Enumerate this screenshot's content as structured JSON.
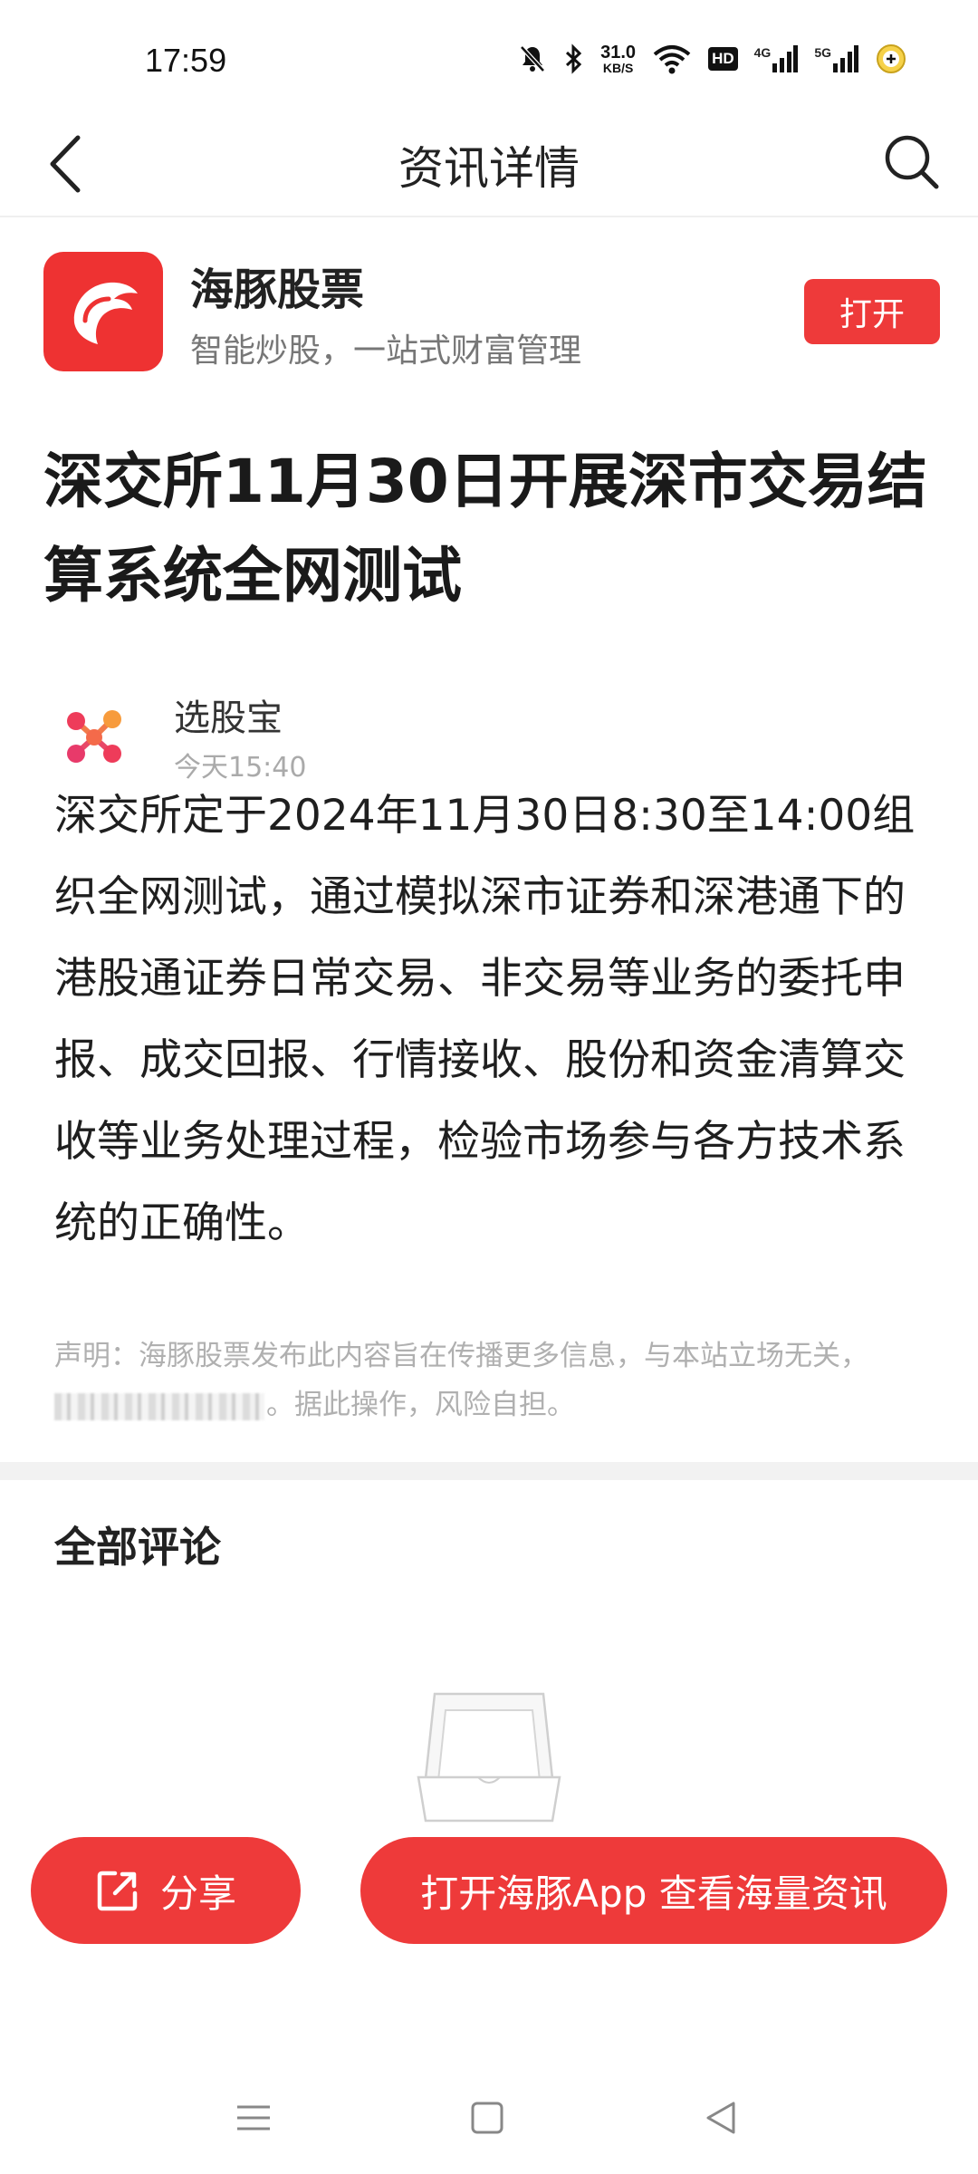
{
  "status_bar": {
    "time": "17:59",
    "net_speed_value": "31.0",
    "net_speed_unit": "KB/S",
    "hd_label": "HD",
    "signal1_label": "4G",
    "signal2_label": "5G",
    "icons": [
      "mute-bell-icon",
      "bluetooth-icon",
      "wifi-icon",
      "signal-icon",
      "battery-saver-icon"
    ]
  },
  "header": {
    "title": "资讯详情"
  },
  "app_banner": {
    "name": "海豚股票",
    "slogan": "智能炒股，一站式财富管理",
    "open_label": "打开",
    "logo_color": "#ee3232"
  },
  "article": {
    "title": "深交所11月30日开展深市交易结算系统全网测试",
    "author": "选股宝",
    "time": "今天15:40",
    "body": "深交所定于2024年11月30日8:30至14:00组织全网测试，通过模拟深市证券和深港通下的港股通证券日常交易、非交易等业务的委托申报、成交回报、行情接收、股份和资金清算交收等业务处理过程，检验市场参与各方技术系统的正确性。",
    "disclaimer_line1": "声明：海豚股票发布此内容旨在传播更多信息，与本站立场无关，",
    "disclaimer_line2": "。据此操作，风险自担。"
  },
  "comments": {
    "title": "全部评论"
  },
  "actions": {
    "share_label": "分享",
    "open_app_label": "打开海豚App 查看海量资讯"
  },
  "colors": {
    "accent": "#ee3a3a",
    "muted_text": "#b0b0b0"
  }
}
